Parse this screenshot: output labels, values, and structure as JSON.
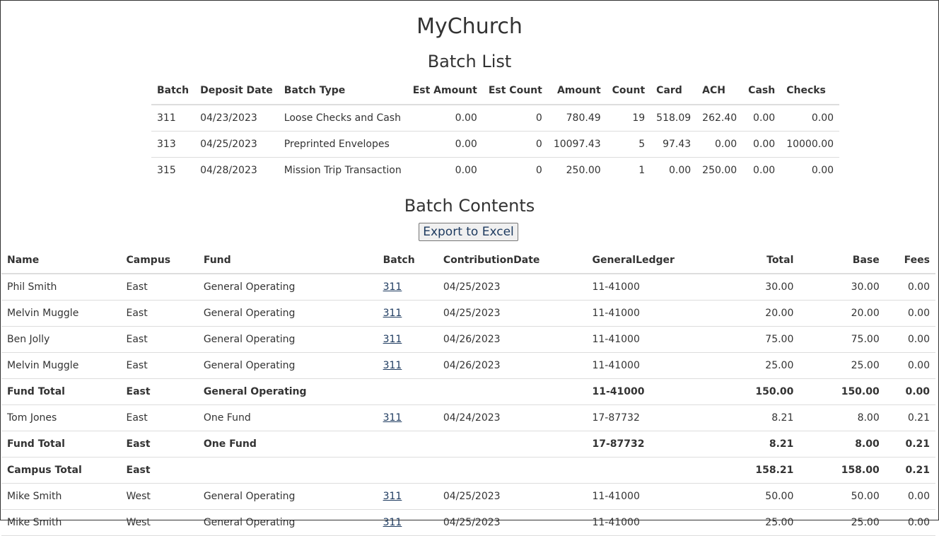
{
  "app_title": "MyChurch",
  "batch_list": {
    "title": "Batch List",
    "columns": [
      "Batch",
      "Deposit Date",
      "Batch Type",
      "Est Amount",
      "Est Count",
      "Amount",
      "Count",
      "Card",
      "ACH",
      "Cash",
      "Checks"
    ],
    "rows": [
      [
        "311",
        "04/23/2023",
        "Loose Checks and Cash",
        "0.00",
        "0",
        "780.49",
        "19",
        "518.09",
        "262.40",
        "0.00",
        "0.00"
      ],
      [
        "313",
        "04/25/2023",
        "Preprinted Envelopes",
        "0.00",
        "0",
        "10097.43",
        "5",
        "97.43",
        "0.00",
        "0.00",
        "10000.00"
      ],
      [
        "315",
        "04/28/2023",
        "Mission Trip Transaction",
        "0.00",
        "0",
        "250.00",
        "1",
        "0.00",
        "250.00",
        "0.00",
        "0.00"
      ]
    ]
  },
  "batch_contents": {
    "title": "Batch Contents",
    "export_label": "Export to Excel",
    "columns": [
      "Name",
      "Campus",
      "Fund",
      "Batch",
      "ContributionDate",
      "GeneralLedger",
      "Total",
      "Base",
      "Fees"
    ],
    "rows": [
      {
        "name": "Phil Smith",
        "campus": "East",
        "fund": "General Operating",
        "batch": "311",
        "date": "04/25/2023",
        "ledger": "11-41000",
        "total": "30.00",
        "base": "30.00",
        "fees": "0.00"
      },
      {
        "name": "Melvin Muggle",
        "campus": "East",
        "fund": "General Operating",
        "batch": "311",
        "date": "04/25/2023",
        "ledger": "11-41000",
        "total": "20.00",
        "base": "20.00",
        "fees": "0.00"
      },
      {
        "name": "Ben Jolly",
        "campus": "East",
        "fund": "General Operating",
        "batch": "311",
        "date": "04/26/2023",
        "ledger": "11-41000",
        "total": "75.00",
        "base": "75.00",
        "fees": "0.00"
      },
      {
        "name": "Melvin Muggle",
        "campus": "East",
        "fund": "General Operating",
        "batch": "311",
        "date": "04/26/2023",
        "ledger": "11-41000",
        "total": "25.00",
        "base": "25.00",
        "fees": "0.00"
      },
      {
        "name": "Fund Total",
        "campus": "East",
        "fund": "General Operating",
        "batch": "",
        "date": "",
        "ledger": "11-41000",
        "total": "150.00",
        "base": "150.00",
        "fees": "0.00"
      },
      {
        "name": "Tom Jones",
        "campus": "East",
        "fund": "One Fund",
        "batch": "311",
        "date": "04/24/2023",
        "ledger": "17-87732",
        "total": "8.21",
        "base": "8.00",
        "fees": "0.21"
      },
      {
        "name": "Fund Total",
        "campus": "East",
        "fund": "One Fund",
        "batch": "",
        "date": "",
        "ledger": "17-87732",
        "total": "8.21",
        "base": "8.00",
        "fees": "0.21"
      },
      {
        "name": "Campus Total",
        "campus": "East",
        "fund": "",
        "batch": "",
        "date": "",
        "ledger": "",
        "total": "158.21",
        "base": "158.00",
        "fees": "0.21"
      },
      {
        "name": "Mike Smith",
        "campus": "West",
        "fund": "General Operating",
        "batch": "311",
        "date": "04/25/2023",
        "ledger": "11-41000",
        "total": "50.00",
        "base": "50.00",
        "fees": "0.00"
      },
      {
        "name": "Mike Smith",
        "campus": "West",
        "fund": "General Operating",
        "batch": "311",
        "date": "04/25/2023",
        "ledger": "11-41000",
        "total": "25.00",
        "base": "25.00",
        "fees": "0.00"
      }
    ]
  }
}
